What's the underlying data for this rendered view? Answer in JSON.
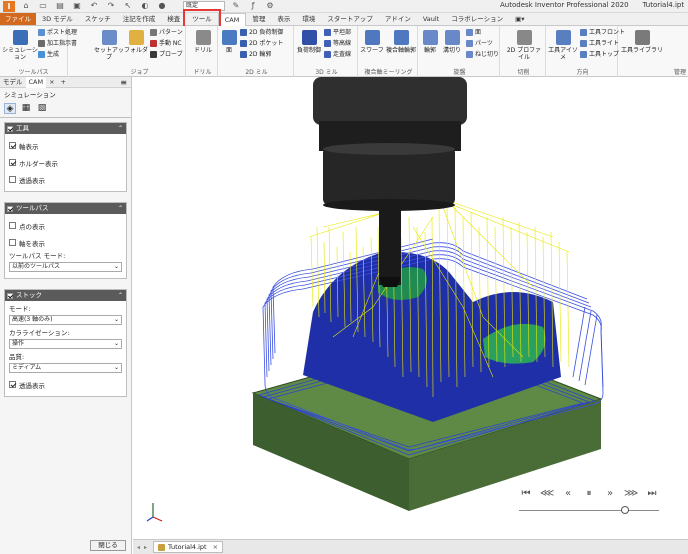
{
  "titlebar": {
    "project_select": "既定",
    "app_name": "Autodesk Inventor Professional 2020",
    "document_name": "Tutorial4.ipt"
  },
  "tabs": {
    "file": "ファイル",
    "model3d": "3D モデル",
    "sketch": "スケッチ",
    "annotate": "注記を作成",
    "inspect": "検査",
    "tools": "ツール",
    "cam": "CAM",
    "manage": "管理",
    "view": "表示",
    "environment": "環境",
    "getstarted": "スタートアップ",
    "addins": "アドイン",
    "vault": "Vault",
    "collaborate": "コラボレーション"
  },
  "ribbon": {
    "toolpath": {
      "label": "ツールパス",
      "simulation": "シミュレーション",
      "post": "ポスト処理",
      "setup_sheet": "加工指示書",
      "generate": "生成"
    },
    "job": {
      "label": "ジョブ",
      "setup": "セットアップ",
      "folder": "フォルダ",
      "pattern": "パターン",
      "manual_nc": "手動 NC",
      "probe": "プローブ"
    },
    "drill": {
      "label": "ドリル",
      "drill": "ドリル"
    },
    "milling2d": {
      "label": "2D ミル",
      "face": "面",
      "adaptive2d": "2D 負荷制御",
      "pocket2d": "2D ポケット",
      "contour2d": "2D 輪郭"
    },
    "milling3d": {
      "label": "3D ミル",
      "adaptive": "負荷制御",
      "horizontal": "平坦部",
      "contour": "等高線",
      "parallel": "走査線"
    },
    "multiaxis": {
      "label": "複合軸ミーリング",
      "swarf": "スワーフ",
      "multiaxis_contour": "複合軸輪郭"
    },
    "turning": {
      "label": "旋盤",
      "profile": "輪郭",
      "groove": "溝切り",
      "face": "面",
      "part": "パーツ",
      "thread": "ねじ切り"
    },
    "cutting": {
      "label": "切削",
      "profile2d": "2D プロファイル"
    },
    "orientation": {
      "label": "方向",
      "tool_iso": "工具アイソメ",
      "tool_front": "工具フロント",
      "tool_right": "工具ライト",
      "tool_top": "工具トップ"
    },
    "manage": {
      "label": "管理",
      "tool_library": "工具ライブラリ"
    }
  },
  "panel": {
    "tabs": [
      "モデル",
      "CAM"
    ],
    "title": "シミュレーション",
    "tool_section": {
      "header": "工具",
      "show_shank": "軸表示",
      "show_holder": "ホルダー表示",
      "transparent": "透過表示"
    },
    "toolpath_section": {
      "header": "ツールパス",
      "show_points": "点の表示",
      "show_axis": "軸を表示",
      "mode_label": "ツールパス モード:",
      "mode_value": "以前のツールパス"
    },
    "stock_section": {
      "header": "ストック",
      "mode_label": "モード:",
      "mode_value": "高速(3 軸のみ)",
      "colorization_label": "カラライゼーション:",
      "colorization_value": "操作",
      "quality_label": "品質:",
      "quality_value": "ミディアム",
      "transparent": "透過表示"
    },
    "close_label": "閉じる"
  },
  "doc_tab": {
    "name": "Tutorial4.ipt"
  },
  "colors": {
    "accent": "#e53935",
    "file_tab": "#d2691e",
    "toolpath_blue": "#2b3fd6",
    "toolpath_yellow": "#e8e800",
    "stock_green": "#4f7a3a"
  }
}
